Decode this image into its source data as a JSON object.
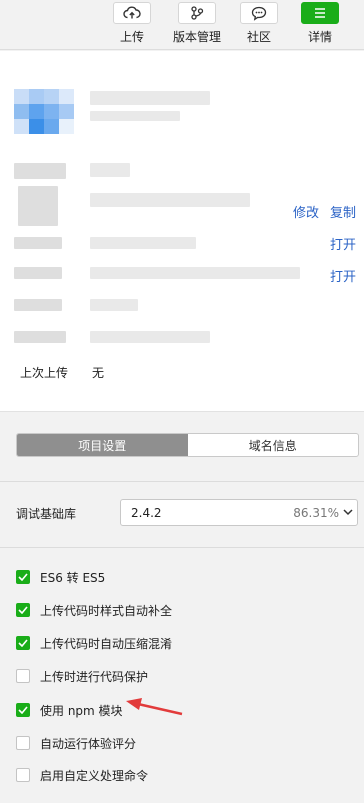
{
  "toolbar": {
    "items": [
      {
        "label": "上传",
        "icon": "cloud-upload-icon"
      },
      {
        "label": "版本管理",
        "icon": "version-branch-icon"
      },
      {
        "label": "社区",
        "icon": "chat-bubble-icon"
      },
      {
        "label": "详情",
        "icon": "menu-icon"
      }
    ],
    "accent": "#1aad19"
  },
  "info": {
    "actions": {
      "edit": "修改",
      "copy": "复制",
      "open1": "打开",
      "open2": "打开"
    },
    "last_upload": {
      "label": "上次上传",
      "value": "无"
    }
  },
  "tabs": [
    {
      "label": "项目设置",
      "active": true
    },
    {
      "label": "域名信息",
      "active": false
    }
  ],
  "base_library": {
    "label": "调试基础库",
    "version": "2.4.2",
    "percent": "86.31%"
  },
  "options": [
    {
      "label": "ES6 转 ES5",
      "checked": true
    },
    {
      "label": "上传代码时样式自动补全",
      "checked": true
    },
    {
      "label": "上传代码时自动压缩混淆",
      "checked": true
    },
    {
      "label": "上传时进行代码保护",
      "checked": false
    },
    {
      "label": "使用 npm 模块",
      "checked": true
    },
    {
      "label": "自动运行体验评分",
      "checked": false
    },
    {
      "label": "启用自定义处理命令",
      "checked": false
    }
  ]
}
